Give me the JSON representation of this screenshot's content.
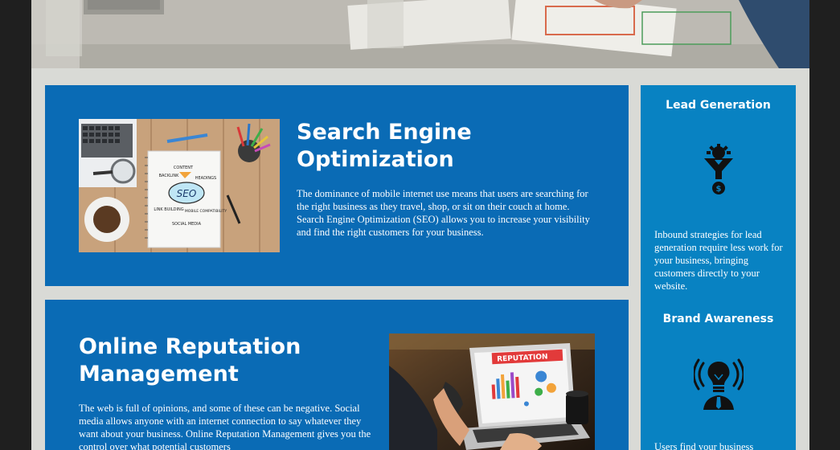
{
  "seo": {
    "title": "Search Engine Optimization",
    "body": "The dominance of mobile internet use means that users are searching for the right business as they travel, shop, or sit on their couch at home. Search Engine Optimization (SEO) allows you to increase your visibility and find the right customers for your business.",
    "image": {
      "center_label": "SEO",
      "labels": [
        "CONTENT",
        "BACKLINK",
        "HEADINGS",
        "LINK BUILDING",
        "MOBILE COMPATIBILITY",
        "SOCIAL MEDIA"
      ]
    }
  },
  "orm": {
    "title": "Online Reputation Management",
    "body": "The web is full of opinions, and some of these can be negative. Social media allows anyone with an internet connection to say whatever they want about your business. Online Reputation Management gives you the control over what potential customers",
    "image": {
      "screen_label": "REPUTATION"
    }
  },
  "sidebar": {
    "lead": {
      "title": "Lead Generation",
      "icon": "funnel-gear-icon",
      "body": "Inbound strategies for lead generation require less work for your business, bringing customers directly to your website."
    },
    "brand": {
      "title": "Brand Awareness",
      "icon": "lightbulb-person-icon",
      "body": "Users find your business"
    }
  },
  "colors": {
    "card": "#0a6bb5",
    "sidebar": "#0882c2",
    "page_bg": "#d9dad6",
    "outer_bg": "#1f1f1f"
  }
}
